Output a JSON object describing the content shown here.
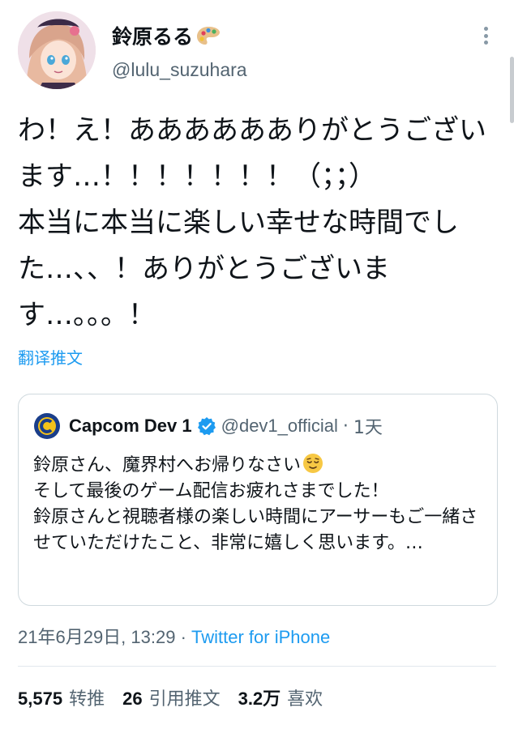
{
  "author": {
    "display_name": "鈴原るる",
    "handle": "@lulu_suzuhara",
    "name_emoji": "palette-icon",
    "avatar": "anime-girl-avatar"
  },
  "tweet": {
    "text": "わ！え！あああああありがとうございます…！！！！！！！（；；）\n本当に本当に楽しい幸せな時間でした…、、！ありがとうございます…。。。！",
    "translate_label": "翻译推文"
  },
  "quote": {
    "name": "Capcom Dev 1",
    "handle": "@dev1_official",
    "separator": "·",
    "time": "1天",
    "text": "鈴原さん、魔界村へお帰りなさい",
    "emoji": "relieved-face-emoji",
    "text_rest": "\nそして最後のゲーム配信お疲れさまでした！\n鈴原さんと視聴者様の楽しい時間にアーサーもご一緒させていただけたこと、非常に嬉しく思います。…",
    "verified": true
  },
  "meta": {
    "timestamp": "21年6月29日, 13:29",
    "separator": " · ",
    "source": "Twitter for iPhone"
  },
  "stats": {
    "retweets_count": "5,575",
    "retweets_label": "转推",
    "quotes_count": "26",
    "quotes_label": "引用推文",
    "likes_count": "3.2万",
    "likes_label": "喜欢"
  },
  "colors": {
    "link": "#1d9bf0",
    "secondary_text": "#536471",
    "border": "#cfd9de"
  }
}
